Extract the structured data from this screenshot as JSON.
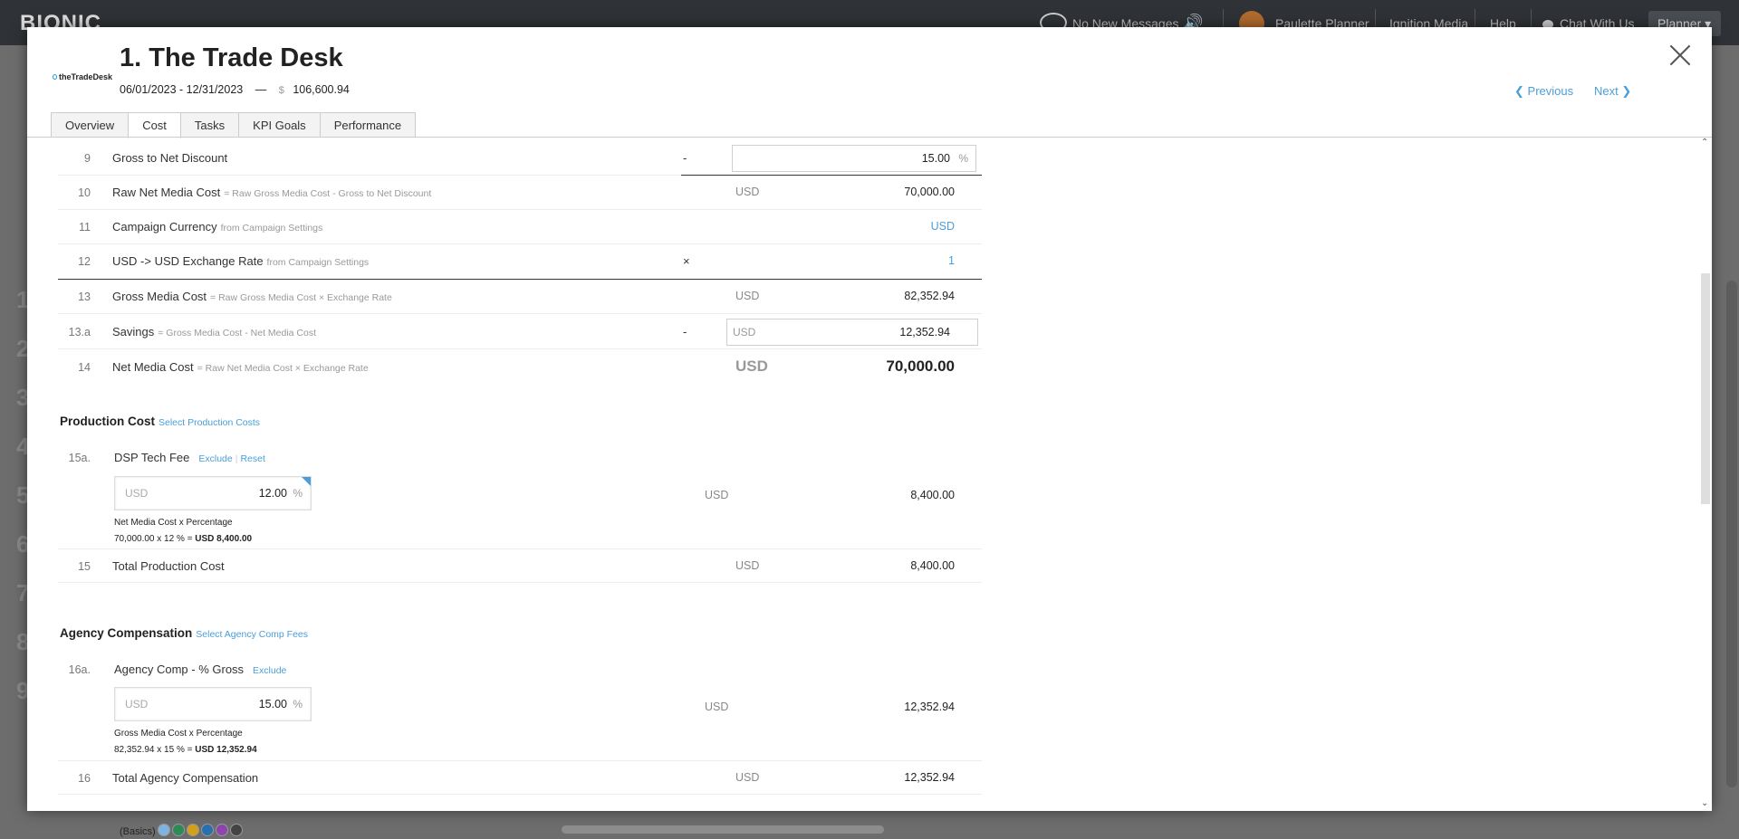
{
  "topbar": {
    "logo": "BIONIC",
    "messages": "No New Messages",
    "user": "Paulette Planner",
    "company": "Ignition Media",
    "help": "Help",
    "chat": "Chat With Us",
    "role": "Planner"
  },
  "background": {
    "row_numbers": [
      "1",
      "2",
      "3",
      "4",
      "5",
      "6",
      "7",
      "8",
      "9"
    ],
    "basics": "(Basics)"
  },
  "modal": {
    "vendor_logo": "theTradeDesk",
    "title": "1. The Trade Desk",
    "date_range": "06/01/2023 - 12/31/2023",
    "dash": "—",
    "currency_symbol": "$",
    "budget": "106,600.94",
    "previous": "Previous",
    "next": "Next",
    "tabs": [
      "Overview",
      "Cost",
      "Tasks",
      "KPI Goals",
      "Performance"
    ],
    "active_tab": "Cost"
  },
  "rows": {
    "r9": {
      "num": "9",
      "label": "Gross to Net Discount",
      "note": "",
      "op": "-",
      "value": "15.00",
      "unit": "%"
    },
    "r10": {
      "num": "10",
      "label": "Raw Net Media Cost",
      "note": "= Raw Gross Media Cost - Gross to Net Discount",
      "currency": "USD",
      "value": "70,000.00"
    },
    "r11": {
      "num": "11",
      "label": "Campaign Currency",
      "note": "from Campaign Settings",
      "value": "USD"
    },
    "r12": {
      "num": "12",
      "label": "USD -> USD Exchange Rate",
      "note": "from Campaign Settings",
      "op": "×",
      "value": "1"
    },
    "r13": {
      "num": "13",
      "label": "Gross Media Cost",
      "note": "= Raw Gross Media Cost × Exchange Rate",
      "currency": "USD",
      "value": "82,352.94"
    },
    "r13a": {
      "num": "13.a",
      "label": "Savings",
      "note": "= Gross Media Cost - Net Media Cost",
      "op": "-",
      "currency": "USD",
      "value": "12,352.94"
    },
    "r14": {
      "num": "14",
      "label": "Net Media Cost",
      "note": "= Raw Net Media Cost × Exchange Rate",
      "currency": "USD",
      "value": "70,000.00"
    }
  },
  "production": {
    "title": "Production Cost",
    "select_link": "Select Production Costs",
    "fee": {
      "num": "15a.",
      "label": "DSP Tech Fee",
      "exclude": "Exclude",
      "reset": "Reset",
      "input_currency": "USD",
      "input_value": "12.00",
      "input_unit": "%",
      "calc_formula": "Net Media Cost x Percentage",
      "calc_line": "70,000.00 x 12 % =",
      "calc_result": "USD 8,400.00",
      "currency": "USD",
      "value": "8,400.00"
    },
    "total": {
      "num": "15",
      "label": "Total Production Cost",
      "currency": "USD",
      "value": "8,400.00"
    }
  },
  "agency": {
    "title": "Agency Compensation",
    "select_link": "Select Agency Comp Fees",
    "fee": {
      "num": "16a.",
      "label": "Agency Comp - % Gross",
      "exclude": "Exclude",
      "input_currency": "USD",
      "input_value": "15.00",
      "input_unit": "%",
      "calc_formula": "Gross Media Cost x Percentage",
      "calc_line": "82,352.94 x 15 % =",
      "calc_result": "USD 12,352.94",
      "currency": "USD",
      "value": "12,352.94"
    },
    "total": {
      "num": "16",
      "label": "Total Agency Compensation",
      "currency": "USD",
      "value": "12,352.94"
    }
  }
}
